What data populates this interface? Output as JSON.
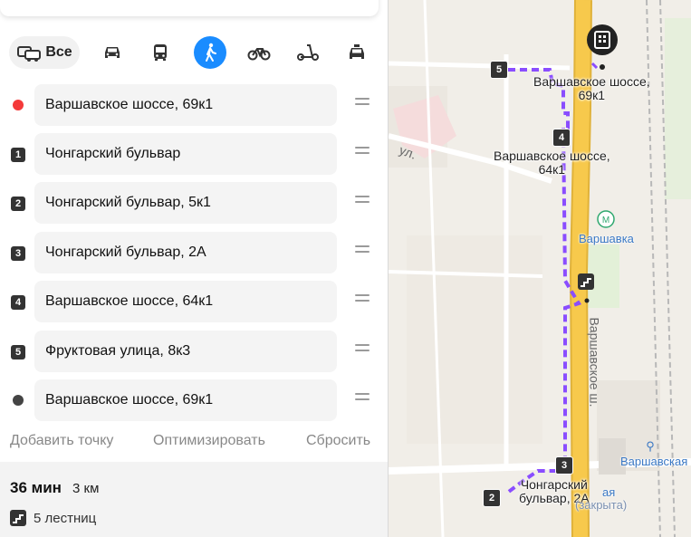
{
  "transport_modes": [
    {
      "name": "all",
      "label": "Все",
      "icon": "car-and-bus-icon",
      "active": false
    },
    {
      "name": "car",
      "icon": "car-icon",
      "active": false
    },
    {
      "name": "transit",
      "icon": "bus-icon",
      "active": false
    },
    {
      "name": "walk",
      "icon": "pedestrian-icon",
      "active": true
    },
    {
      "name": "bike",
      "icon": "bicycle-icon",
      "active": false
    },
    {
      "name": "scooter",
      "icon": "scooter-icon",
      "active": false
    },
    {
      "name": "taxi",
      "icon": "taxi-icon",
      "active": false
    }
  ],
  "waypoints": [
    {
      "marker": "start-dot",
      "value": "Варшавское шоссе, 69к1"
    },
    {
      "marker": "1",
      "value": "Чонгарский бульвар"
    },
    {
      "marker": "2",
      "value": "Чонгарский бульвар, 5к1"
    },
    {
      "marker": "3",
      "value": "Чонгарский бульвар, 2А"
    },
    {
      "marker": "4",
      "value": "Варшавское шоссе, 64к1"
    },
    {
      "marker": "5",
      "value": "Фруктовая улица, 8к3"
    },
    {
      "marker": "end-dot",
      "value": "Варшавское шоссе, 69к1"
    }
  ],
  "actions": {
    "add_point": "Добавить точку",
    "optimize": "Оптимизировать",
    "reset": "Сбросить"
  },
  "summary": {
    "time": "36 мин",
    "distance": "3 км",
    "stairs": "5 лестниц"
  },
  "map": {
    "labels": {
      "start": "Варшавское шоссе,\n69к1",
      "wp4": "Варшавское шоссе,\n64к1",
      "wp3": "Чонгарский\nбульвар, 2А",
      "street_highway": "Варшавское ш.",
      "street_ul": "ул.",
      "metro_1": "Варшавка",
      "metro_2": "Варшавская",
      "station_hidden": "(закрыта)",
      "station_suffix": "ая"
    },
    "badges": [
      "5",
      "4",
      "3",
      "2"
    ],
    "colors": {
      "route": "#8a4dff",
      "highway": "#f7c94c",
      "start_pin": "#222222",
      "start_dot": "#f43a3a",
      "mode_active": "#1a8cff"
    }
  }
}
